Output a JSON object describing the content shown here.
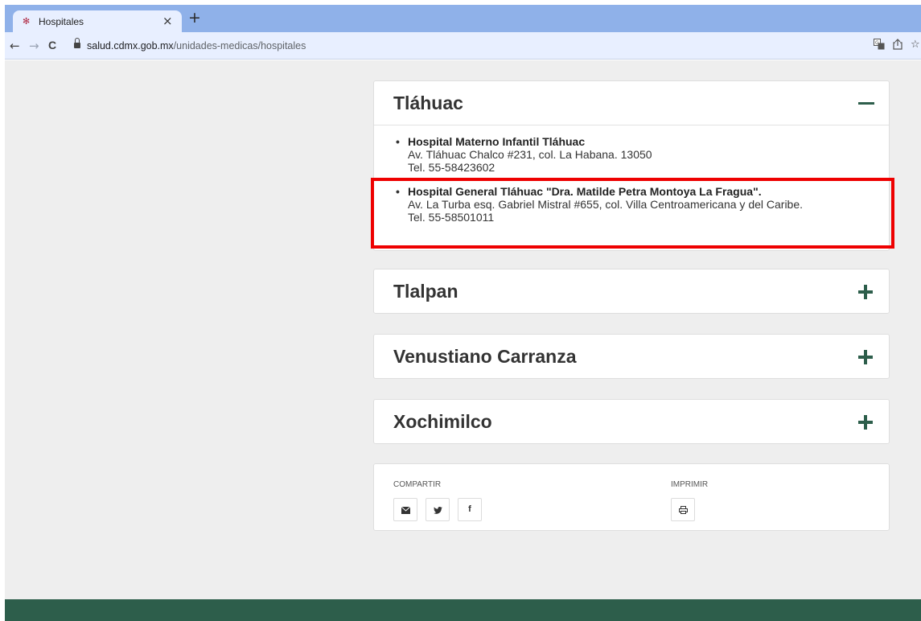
{
  "browser": {
    "tab_title": "Hospitales",
    "close_glyph": "×",
    "new_tab_glyph": "+",
    "url_host": "salud.cdmx.gob.mx",
    "url_path": "/unidades-medicas/hospitales",
    "back_glyph": "←",
    "forward_glyph": "→",
    "reload_glyph": "C"
  },
  "sections": [
    {
      "title": "Tláhuac",
      "expanded": true,
      "hospitals": [
        {
          "name": "Hospital Materno Infantil Tláhuac",
          "address": "Av. Tláhuac Chalco #231, col. La Habana. 13050",
          "phone": "Tel. 55-58423602"
        },
        {
          "name": "Hospital General Tláhuac \"Dra. Matilde Petra Montoya La Fragua\".",
          "address": "Av. La Turba esq. Gabriel Mistral #655, col. Villa Centroamericana y del Caribe.",
          "phone": "Tel. 55-58501011",
          "highlighted": true
        }
      ]
    },
    {
      "title": "Tlalpan",
      "expanded": false
    },
    {
      "title": "Venustiano Carranza",
      "expanded": false
    },
    {
      "title": "Xochimilco",
      "expanded": false
    }
  ],
  "share": {
    "share_label": "COMPARTIR",
    "print_label": "IMPRIMIR",
    "twitter_glyph": "𝕪",
    "facebook_glyph": "f"
  },
  "colors": {
    "accent": "#2d5e4b",
    "highlight": "#ee0000",
    "page_bg": "#eeeeee"
  }
}
